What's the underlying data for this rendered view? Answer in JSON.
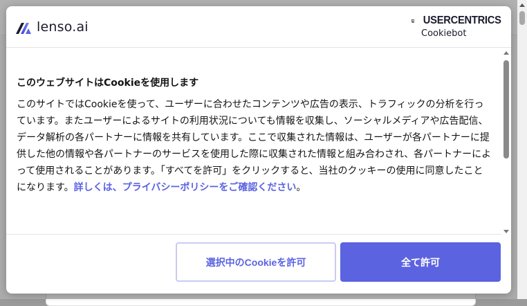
{
  "brand": {
    "name": "lenso.ai",
    "icon": "lenso-logo-icon"
  },
  "cmp": {
    "name": "USERCENTRICS",
    "subtitle": "Cookiebot",
    "icon": "usercentrics-shield-icon"
  },
  "consent": {
    "title": "このウェブサイトはCookieを使用します",
    "body": "このサイトではCookieを使って、ユーザーに合わせたコンテンツや広告の表示、トラフィックの分析を行っています。またユーザーによるサイトの利用状況についても情報を収集し、ソーシャルメディアや広告配信、データ解析の各パートナーに情報を共有しています。ここで収集された情報は、ユーザーが各パートナーに提供した他の情報や各パートナーのサービスを使用した際に収集された情報と組み合わされ、各パートナーによって使用されることがあります。「すべてを許可」をクリックすると、当社のクッキーの使用に同意したことになります。",
    "link_text": "詳しくは、プライバシーポリシーをご確認ください",
    "link_suffix": "。"
  },
  "buttons": {
    "allow_selection": "選択中のCookieを許可",
    "allow_all": "全て許可"
  },
  "colors": {
    "accent": "#5b63e0",
    "accent_border": "#c9cbf2",
    "text": "#141414"
  }
}
